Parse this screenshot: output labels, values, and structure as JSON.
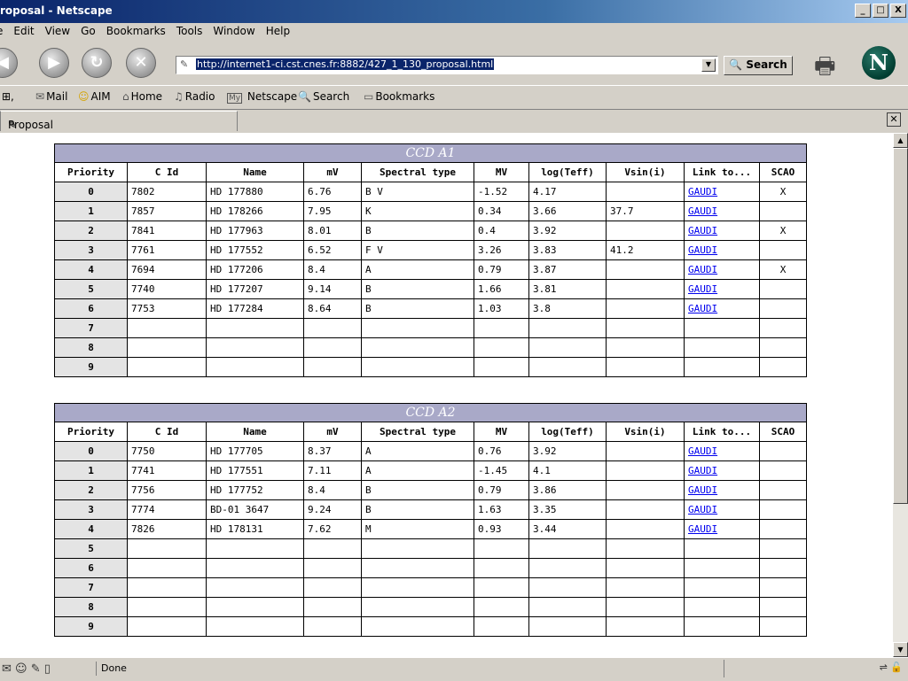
{
  "window": {
    "title": "roposal - Netscape",
    "min": "_",
    "max": "□",
    "close": "X"
  },
  "menu": [
    "e",
    "Edit",
    "View",
    "Go",
    "Bookmarks",
    "Tools",
    "Window",
    "Help"
  ],
  "nav": {
    "back": "◀",
    "forward": "▶",
    "reload": "↻",
    "stop": "✕",
    "url": "http://internet1-ci.cst.cnes.fr:8882/427_1_130_proposal.html",
    "search_label": "Search"
  },
  "personal_toolbar": {
    "mail": "Mail",
    "aim": "AIM",
    "home": "Home",
    "radio": "Radio",
    "my_netscape": "Netscape",
    "search": "Search",
    "bookmarks": "Bookmarks"
  },
  "tab": {
    "label": "Proposal"
  },
  "columns": [
    "Priority",
    "C Id",
    "Name",
    "mV",
    "Spectral type",
    "MV",
    "log(Teff)",
    "Vsin(i)",
    "Link to...",
    "SCAO"
  ],
  "tables": [
    {
      "title": "CCD A1",
      "rows": [
        [
          "0",
          "7802",
          "HD 177880",
          "6.76",
          "B V",
          "-1.52",
          "4.17",
          "",
          "GAUDI",
          "X"
        ],
        [
          "1",
          "7857",
          "HD 178266",
          "7.95",
          "K",
          "0.34",
          "3.66",
          "37.7",
          "GAUDI",
          ""
        ],
        [
          "2",
          "7841",
          "HD 177963",
          "8.01",
          "B",
          "0.4",
          "3.92",
          "",
          "GAUDI",
          "X"
        ],
        [
          "3",
          "7761",
          "HD 177552",
          "6.52",
          "F V",
          "3.26",
          "3.83",
          "41.2",
          "GAUDI",
          ""
        ],
        [
          "4",
          "7694",
          "HD 177206",
          "8.4",
          "A",
          "0.79",
          "3.87",
          "",
          "GAUDI",
          "X"
        ],
        [
          "5",
          "7740",
          "HD 177207",
          "9.14",
          "B",
          "1.66",
          "3.81",
          "",
          "GAUDI",
          ""
        ],
        [
          "6",
          "7753",
          "HD 177284",
          "8.64",
          "B",
          "1.03",
          "3.8",
          "",
          "GAUDI",
          ""
        ],
        [
          "7",
          "",
          "",
          "",
          "",
          "",
          "",
          "",
          "",
          ""
        ],
        [
          "8",
          "",
          "",
          "",
          "",
          "",
          "",
          "",
          "",
          ""
        ],
        [
          "9",
          "",
          "",
          "",
          "",
          "",
          "",
          "",
          "",
          ""
        ]
      ]
    },
    {
      "title": "CCD A2",
      "rows": [
        [
          "0",
          "7750",
          "HD 177705",
          "8.37",
          "A",
          "0.76",
          "3.92",
          "",
          "GAUDI",
          ""
        ],
        [
          "1",
          "7741",
          "HD 177551",
          "7.11",
          "A",
          "-1.45",
          "4.1",
          "",
          "GAUDI",
          ""
        ],
        [
          "2",
          "7756",
          "HD 177752",
          "8.4",
          "B",
          "0.79",
          "3.86",
          "",
          "GAUDI",
          ""
        ],
        [
          "3",
          "7774",
          "BD-01 3647",
          "9.24",
          "B",
          "1.63",
          "3.35",
          "",
          "GAUDI",
          ""
        ],
        [
          "4",
          "7826",
          "HD 178131",
          "7.62",
          "M",
          "0.93",
          "3.44",
          "",
          "GAUDI",
          ""
        ],
        [
          "5",
          "",
          "",
          "",
          "",
          "",
          "",
          "",
          "",
          ""
        ],
        [
          "6",
          "",
          "",
          "",
          "",
          "",
          "",
          "",
          "",
          ""
        ],
        [
          "7",
          "",
          "",
          "",
          "",
          "",
          "",
          "",
          "",
          ""
        ],
        [
          "8",
          "",
          "",
          "",
          "",
          "",
          "",
          "",
          "",
          ""
        ],
        [
          "9",
          "",
          "",
          "",
          "",
          "",
          "",
          "",
          "",
          ""
        ]
      ]
    }
  ],
  "status": {
    "text": "Done"
  }
}
